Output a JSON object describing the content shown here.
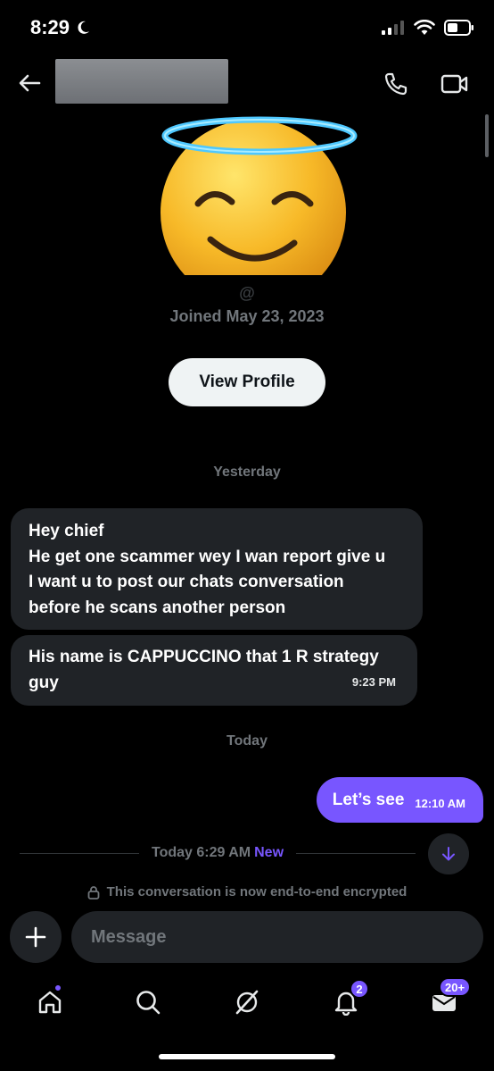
{
  "status_bar": {
    "time": "8:29",
    "moon_icon": "moon-icon",
    "signal_icon": "signal-icon",
    "wifi_icon": "wifi-icon",
    "battery_icon": "battery-icon"
  },
  "header": {
    "back_icon": "back-arrow-icon",
    "call_icon": "phone-icon",
    "video_icon": "video-icon"
  },
  "profile": {
    "handle": "@",
    "joined": "Joined May 23, 2023",
    "view_profile_label": "View Profile",
    "avatar_icon": "smiling-face-with-halo-icon"
  },
  "conversation": {
    "date_yesterday": "Yesterday",
    "messages_in": [
      {
        "text": "Hey chief\nHe get one scammer wey I wan report give u\nI want u to post our chats conversation\nbefore he scans another person",
        "time": ""
      },
      {
        "text": "His name is CAPPUCCINO that 1 R strategy\nguy",
        "time": "9:23 PM"
      }
    ],
    "date_today": "Today",
    "message_out": {
      "text": "Let’s see",
      "time": "12:10 AM"
    },
    "new_divider": {
      "label": "Today 6:29 AM",
      "new_label": "New"
    },
    "encrypted_notice": "This conversation is now end-to-end encrypted"
  },
  "composer": {
    "placeholder": "Message"
  },
  "tab_bar": {
    "items": [
      {
        "name": "home",
        "icon": "home-icon",
        "badge": ""
      },
      {
        "name": "search",
        "icon": "search-icon",
        "badge": ""
      },
      {
        "name": "grok",
        "icon": "grok-icon",
        "badge": ""
      },
      {
        "name": "notifications",
        "icon": "bell-icon",
        "badge": "2"
      },
      {
        "name": "messages",
        "icon": "mail-icon",
        "badge": "20+"
      }
    ]
  },
  "colors": {
    "accent": "#7856ff",
    "background": "#000000",
    "bubble_incoming": "#202327",
    "muted_text": "#71767b"
  }
}
